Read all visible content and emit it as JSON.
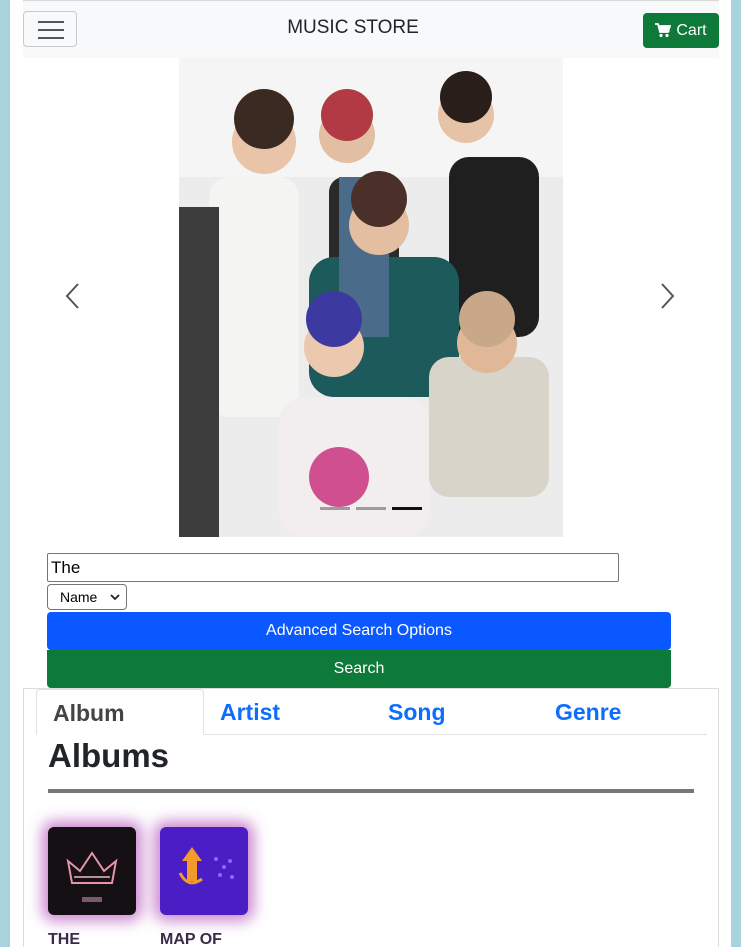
{
  "navbar": {
    "brand": "MUSIC STORE",
    "cart_label": "Cart",
    "cart_icon": "shopping-cart-icon",
    "toggle_icon": "hamburger-menu-icon"
  },
  "carousel": {
    "prev_icon": "chevron-left-icon",
    "next_icon": "chevron-right-icon",
    "slide_count": 3,
    "active_slide": 3
  },
  "search": {
    "query": "The",
    "field_selected": "Name",
    "advanced_label": "Advanced Search Options",
    "search_label": "Search"
  },
  "tabs": [
    {
      "label": "Album",
      "active": true
    },
    {
      "label": "Artist",
      "active": false
    },
    {
      "label": "Song",
      "active": false
    },
    {
      "label": "Genre",
      "active": false
    }
  ],
  "albums_section": {
    "title": "Albums",
    "items": [
      {
        "name": "THE"
      },
      {
        "name": "MAP OF"
      }
    ]
  },
  "colors": {
    "page_bg": "#a8d3de",
    "success": "#0e7a3a",
    "primary": "#0a58ff",
    "link": "#0d6efd"
  }
}
